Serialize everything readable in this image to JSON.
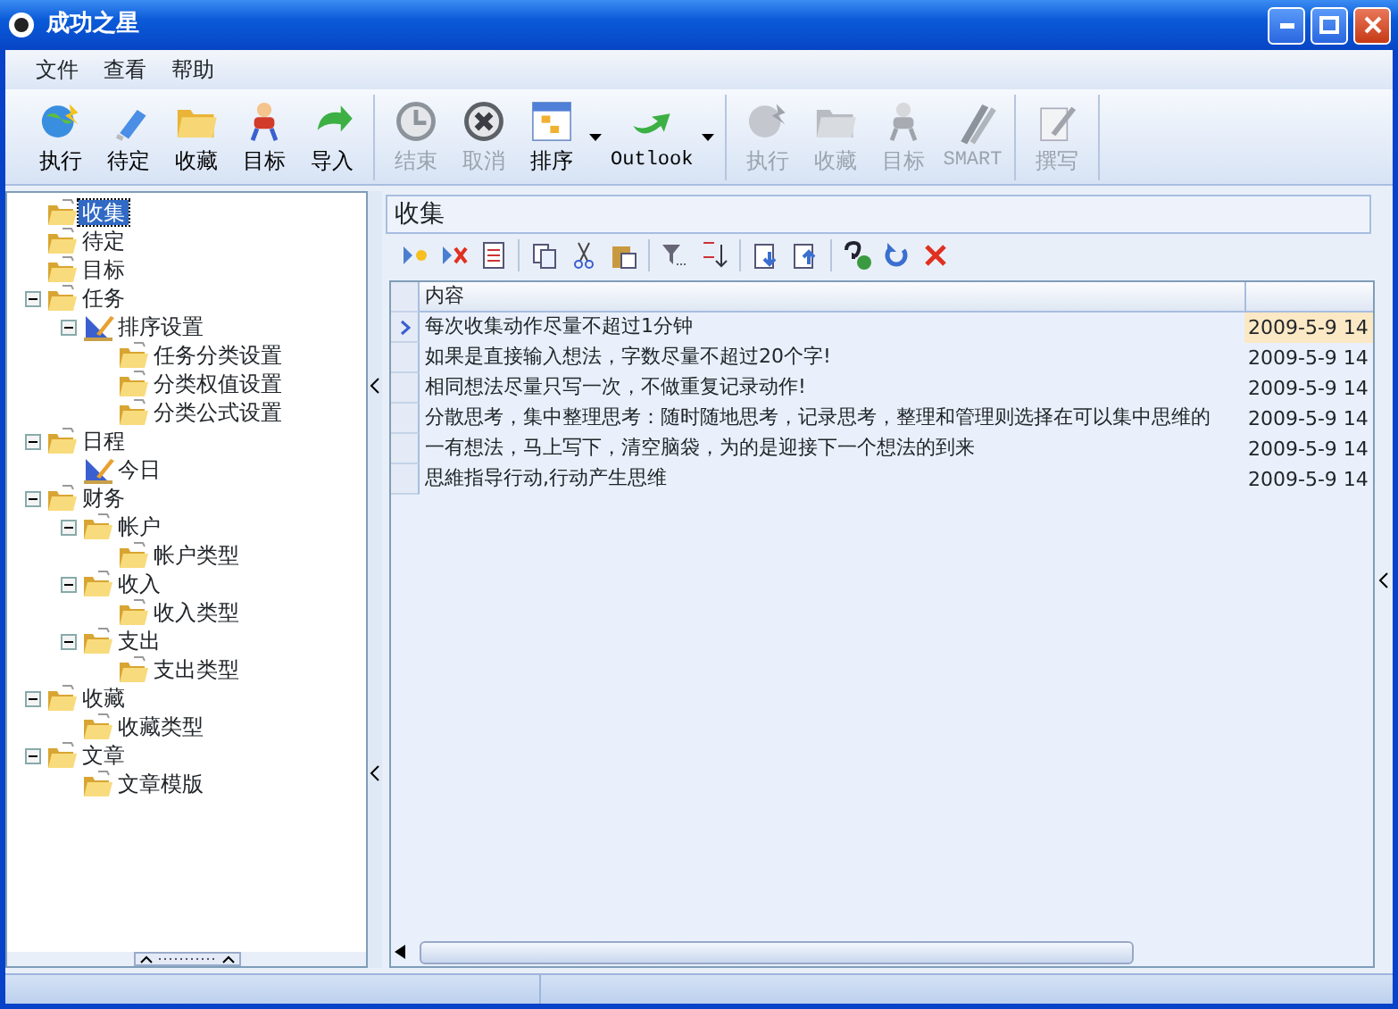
{
  "window": {
    "title": "成功之星"
  },
  "menu": [
    "文件",
    "查看",
    "帮助"
  ],
  "toolbar_groups": [
    [
      {
        "label": "执行",
        "disabled": false,
        "kind": "button"
      },
      {
        "label": "待定",
        "disabled": false,
        "kind": "button"
      },
      {
        "label": "收藏",
        "disabled": false,
        "kind": "button"
      },
      {
        "label": "目标",
        "disabled": false,
        "kind": "button"
      },
      {
        "label": "导入",
        "disabled": false,
        "kind": "button"
      }
    ],
    [
      {
        "label": "结束",
        "disabled": true,
        "kind": "button"
      },
      {
        "label": "取消",
        "disabled": true,
        "kind": "button"
      },
      {
        "label": "排序",
        "disabled": false,
        "kind": "dropdown"
      },
      {
        "label": "Outlook",
        "disabled": false,
        "kind": "dropdown"
      }
    ],
    [
      {
        "label": "执行",
        "disabled": true,
        "kind": "button"
      },
      {
        "label": "收藏",
        "disabled": true,
        "kind": "button"
      },
      {
        "label": "目标",
        "disabled": true,
        "kind": "button"
      },
      {
        "label": "SMART",
        "disabled": true,
        "kind": "button"
      }
    ],
    [
      {
        "label": "撰写",
        "disabled": true,
        "kind": "button"
      }
    ]
  ],
  "tree": [
    {
      "label": "收集",
      "kind": "folder",
      "selected": true
    },
    {
      "label": "待定",
      "kind": "folder",
      "selected": false
    },
    {
      "label": "目标",
      "kind": "folder",
      "selected": false
    },
    {
      "label": "任务",
      "kind": "folder",
      "selected": false,
      "expanded": true,
      "children": [
        {
          "label": "排序设置",
          "kind": "settings",
          "selected": false,
          "expanded": true,
          "children": [
            {
              "label": "任务分类设置",
              "kind": "folder",
              "selected": false
            },
            {
              "label": "分类权值设置",
              "kind": "folder",
              "selected": false
            },
            {
              "label": "分类公式设置",
              "kind": "folder",
              "selected": false
            }
          ]
        }
      ]
    },
    {
      "label": "日程",
      "kind": "folder",
      "selected": false,
      "expanded": true,
      "children": [
        {
          "label": "今日",
          "kind": "settings",
          "selected": false
        }
      ]
    },
    {
      "label": "财务",
      "kind": "folder",
      "selected": false,
      "expanded": true,
      "children": [
        {
          "label": "帐户",
          "kind": "folder",
          "selected": false,
          "expanded": true,
          "children": [
            {
              "label": "帐户类型",
              "kind": "folder",
              "selected": false
            }
          ]
        },
        {
          "label": "收入",
          "kind": "folder",
          "selected": false,
          "expanded": true,
          "children": [
            {
              "label": "收入类型",
              "kind": "folder",
              "selected": false
            }
          ]
        },
        {
          "label": "支出",
          "kind": "folder",
          "selected": false,
          "expanded": true,
          "children": [
            {
              "label": "支出类型",
              "kind": "folder",
              "selected": false
            }
          ]
        }
      ]
    },
    {
      "label": "收藏",
      "kind": "folder",
      "selected": false,
      "expanded": true,
      "children": [
        {
          "label": "收藏类型",
          "kind": "folder",
          "selected": false
        }
      ]
    },
    {
      "label": "文章",
      "kind": "folder",
      "selected": false,
      "expanded": true,
      "children": [
        {
          "label": "文章模版",
          "kind": "folder",
          "selected": false
        }
      ]
    }
  ],
  "panel": {
    "title": "收集",
    "table": {
      "columns": [
        "内容"
      ],
      "rows": [
        {
          "content": "每次收集动作尽量不超过1分钟",
          "date": "2009-5-9 14",
          "selected": true
        },
        {
          "content": "如果是直接输入想法，字数尽量不超过20个字!",
          "date": "2009-5-9 14",
          "selected": false
        },
        {
          "content": "相同想法尽量只写一次，不做重复记录动作!",
          "date": "2009-5-9 14",
          "selected": false
        },
        {
          "content": "分散思考，集中整理思考：随时随地思考，记录思考，整理和管理则选择在可以集中思维的",
          "date": "2009-5-9 14",
          "selected": false
        },
        {
          "content": "一有想法，马上写下，清空脑袋，为的是迎接下一个想法的到来",
          "date": "2009-5-9 14",
          "selected": false
        },
        {
          "content": "思維指导行动,行动产生思维",
          "date": "2009-5-9 14",
          "selected": false
        }
      ]
    }
  }
}
